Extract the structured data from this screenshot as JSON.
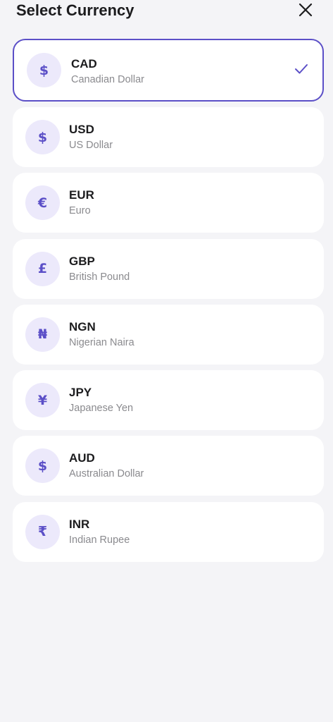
{
  "header": {
    "title": "Select Currency",
    "close_icon": "close-icon"
  },
  "colors": {
    "accent": "#5b4fc7",
    "avatar_bg": "#ece9fb",
    "background": "#f4f4f7",
    "card": "#ffffff"
  },
  "currencies": [
    {
      "code": "CAD",
      "name": "Canadian Dollar",
      "symbol": "$",
      "selected": true
    },
    {
      "code": "USD",
      "name": "US Dollar",
      "symbol": "$",
      "selected": false
    },
    {
      "code": "EUR",
      "name": "Euro",
      "symbol": "€",
      "selected": false
    },
    {
      "code": "GBP",
      "name": "British Pound",
      "symbol": "£",
      "selected": false
    },
    {
      "code": "NGN",
      "name": "Nigerian Naira",
      "symbol": "₦",
      "selected": false
    },
    {
      "code": "JPY",
      "name": "Japanese Yen",
      "symbol": "¥",
      "selected": false
    },
    {
      "code": "AUD",
      "name": "Australian Dollar",
      "symbol": "$",
      "selected": false
    },
    {
      "code": "INR",
      "name": "Indian Rupee",
      "symbol": "₹",
      "selected": false
    }
  ]
}
